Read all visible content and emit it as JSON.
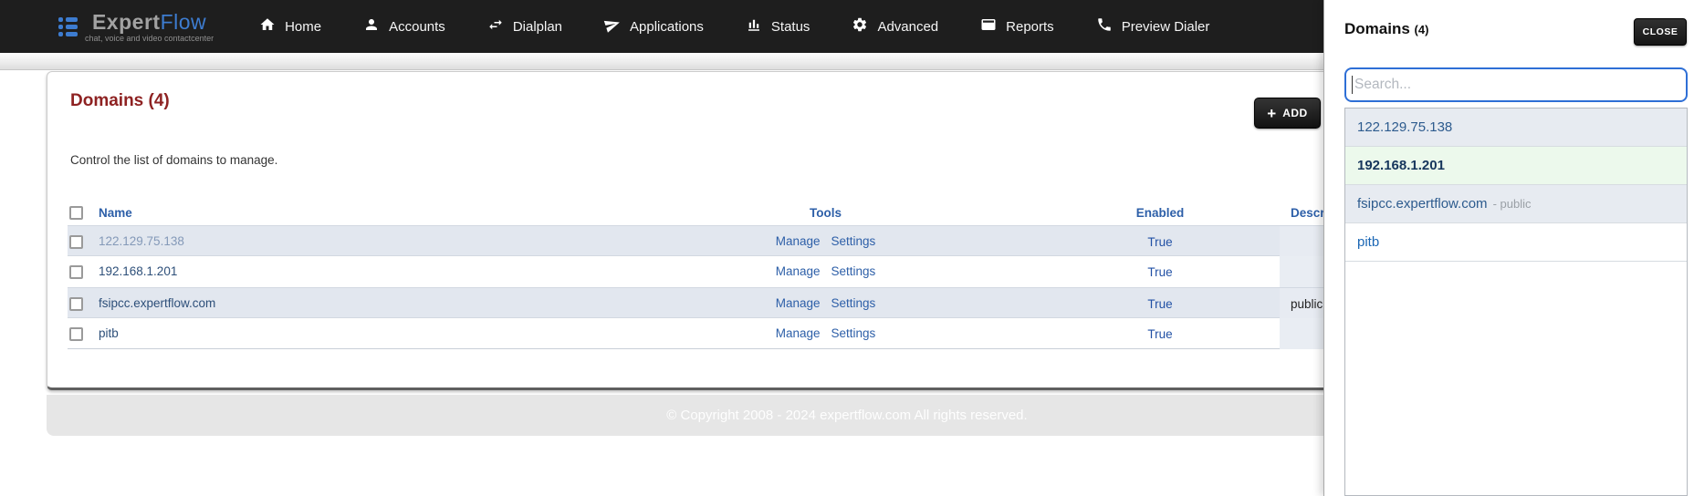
{
  "brand": {
    "name_primary": "Expert",
    "name_secondary": "Flow",
    "tagline": "chat, voice and video contactcenter"
  },
  "nav": {
    "items": [
      {
        "icon": "home-icon",
        "label": "Home"
      },
      {
        "icon": "accounts-icon",
        "label": "Accounts"
      },
      {
        "icon": "dialplan-icon",
        "label": "Dialplan"
      },
      {
        "icon": "applications-icon",
        "label": "Applications"
      },
      {
        "icon": "status-icon",
        "label": "Status"
      },
      {
        "icon": "advanced-icon",
        "label": "Advanced"
      },
      {
        "icon": "reports-icon",
        "label": "Reports"
      },
      {
        "icon": "preview-dialer-icon",
        "label": "Preview Dialer"
      }
    ]
  },
  "page": {
    "title": "Domains",
    "count": "(4)",
    "subtitle": "Control the list of domains to manage.",
    "add_label": "ADD",
    "add_plus": "+",
    "table": {
      "headers": {
        "name": "Name",
        "tools": "Tools",
        "enabled": "Enabled",
        "description": "Description"
      },
      "rows": [
        {
          "name": "122.129.75.138",
          "tools": [
            "Manage",
            "Settings"
          ],
          "enabled": "True",
          "description": ""
        },
        {
          "name": "192.168.1.201",
          "tools": [
            "Manage",
            "Settings"
          ],
          "enabled": "True",
          "description": ""
        },
        {
          "name": "fsipcc.expertflow.com",
          "tools": [
            "Manage",
            "Settings"
          ],
          "enabled": "True",
          "description": "public"
        },
        {
          "name": "pitb",
          "tools": [
            "Manage",
            "Settings"
          ],
          "enabled": "True",
          "description": ""
        }
      ]
    },
    "footer": "© Copyright 2008 - 2024 expertflow.com All rights reserved."
  },
  "panel": {
    "title": "Domains",
    "count": "(4)",
    "close_label": "CLOSE",
    "search_placeholder": "Search...",
    "items": [
      {
        "label": "122.129.75.138",
        "suffix": "",
        "selected": false
      },
      {
        "label": "192.168.1.201",
        "suffix": "",
        "selected": true
      },
      {
        "label": "fsipcc.expertflow.com",
        "suffix": "- public",
        "selected": false
      },
      {
        "label": "pitb",
        "suffix": "",
        "selected": false
      }
    ]
  },
  "colors": {
    "navbar_bg": "#1e1e1e",
    "brand_blue": "#3d7cd0",
    "title_maroon": "#8e2222",
    "table_link_blue": "#2d5fa8",
    "row_shade": "#e2e7ef",
    "selected_green": "#ecf9ec",
    "search_border_blue": "#2e6fd6",
    "footer_band": "#e6e6e6"
  }
}
